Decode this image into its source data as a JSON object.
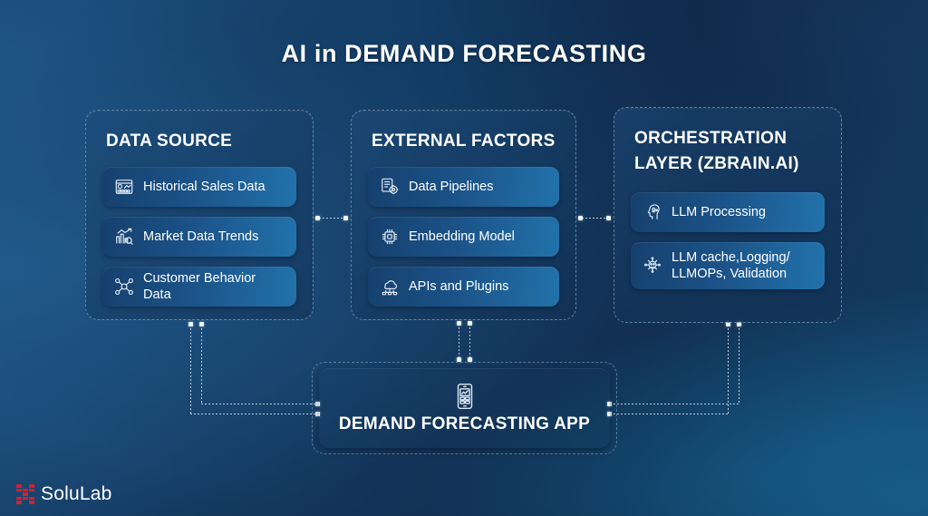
{
  "title": "AI in DEMAND FORECASTING",
  "panels": {
    "data_source": {
      "title": "DATA SOURCE",
      "items": [
        {
          "label": "Historical Sales Data",
          "icon": "dashboard-chart-icon"
        },
        {
          "label": "Market Data Trends",
          "icon": "market-trend-icon"
        },
        {
          "label": "Customer Behavior Data",
          "icon": "customer-behavior-icon"
        }
      ]
    },
    "external_factors": {
      "title": "EXTERNAL FACTORS",
      "items": [
        {
          "label": "Data Pipelines",
          "icon": "data-pipeline-icon"
        },
        {
          "label": "Embedding Model",
          "icon": "chip-embedding-icon"
        },
        {
          "label": "APIs and Plugins",
          "icon": "api-cloud-icon"
        }
      ]
    },
    "orchestration_layer": {
      "title": "ORCHESTRATION LAYER (ZBRAIN.AI)",
      "items": [
        {
          "label": "LLM Processing",
          "icon": "llm-head-icon"
        },
        {
          "label": "LLM cache,Logging/\nLLMOPs, Validation",
          "icon": "llm-ops-icon"
        }
      ]
    }
  },
  "app_box": {
    "label": "DEMAND FORECASTING APP",
    "icon": "mobile-forecast-app-icon"
  },
  "logo": {
    "text": "SoluLab",
    "mark": "solulab-pixel-mark",
    "mark_color": "#d5202f"
  },
  "colors": {
    "background_dark": "#0f2747",
    "background_light": "#1d5382",
    "chip_gradient_start": "#16406e",
    "chip_gradient_end": "#2272ab",
    "text": "#ffffff",
    "connector": "#eef5fc"
  }
}
